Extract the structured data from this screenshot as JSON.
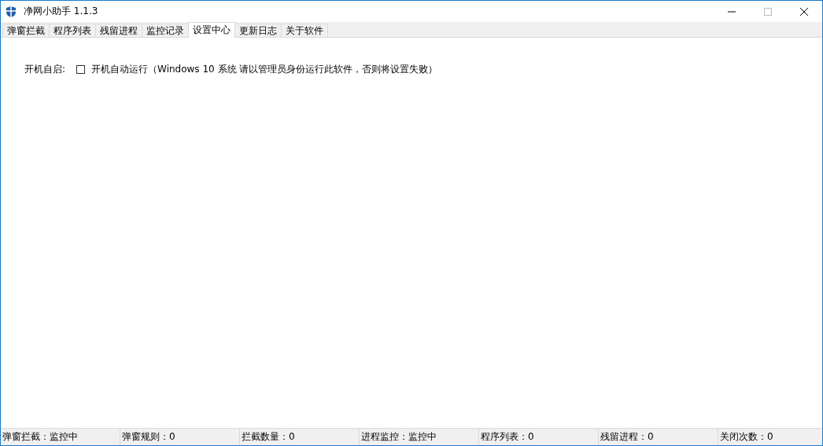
{
  "window": {
    "title": "净网小助手 1.1.3"
  },
  "tabs": [
    {
      "label": "弹窗拦截",
      "selected": false
    },
    {
      "label": "程序列表",
      "selected": false
    },
    {
      "label": "残留进程",
      "selected": false
    },
    {
      "label": "监控记录",
      "selected": false
    },
    {
      "label": "设置中心",
      "selected": true
    },
    {
      "label": "更新日志",
      "selected": false
    },
    {
      "label": "关于软件",
      "selected": false
    }
  ],
  "settings": [
    {
      "label": "开机自启:",
      "option": "开机自动运行（Windows 10 系统 请以管理员身份运行此软件，否则将设置失败）",
      "checked": false
    }
  ],
  "status_bar": [
    "弹窗拦截：监控中",
    "弹窗规则：0",
    "拦截数量：0",
    "进程监控：监控中",
    "程序列表：0",
    "残留进程：0",
    "关闭次数：0"
  ]
}
